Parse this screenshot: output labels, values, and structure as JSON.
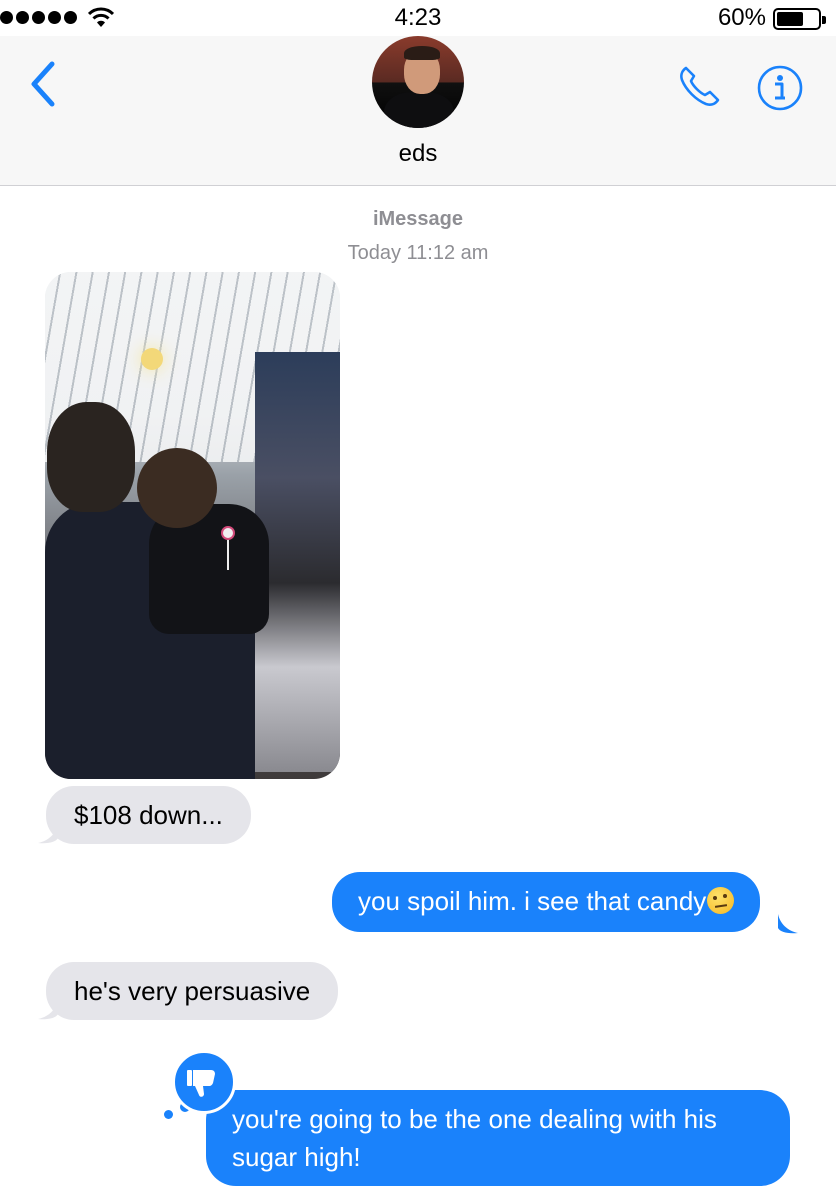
{
  "status_bar": {
    "time": "4:23",
    "battery_percent": "60%",
    "battery_level": 0.6,
    "signal_bars": 5
  },
  "nav": {
    "back_icon": "chevron-left-icon",
    "contact_name": "eds",
    "phone_icon": "phone-icon",
    "info_icon": "info-icon"
  },
  "conversation": {
    "service": "iMessage",
    "timestamp": "Today 11:12 am"
  },
  "messages": [
    {
      "direction": "incoming",
      "type": "photo"
    },
    {
      "direction": "incoming",
      "type": "text",
      "text": "$108 down..."
    },
    {
      "direction": "outgoing",
      "type": "text",
      "text": "you spoil him. i see that candy",
      "emoji": "raised-eyebrow-emoji"
    },
    {
      "direction": "incoming",
      "type": "text",
      "text": "he's very persuasive"
    },
    {
      "direction": "outgoing",
      "type": "text",
      "text": "you're going to be the one dealing with his sugar high!",
      "tapback": "thumbs-down-icon"
    }
  ],
  "colors": {
    "accent": "#1a82fb",
    "incoming_bubble": "#e5e5ea",
    "meta_text": "#8e8e93"
  }
}
